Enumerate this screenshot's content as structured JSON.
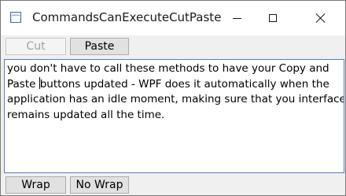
{
  "window": {
    "title": "CommandsCanExecuteCutPaste"
  },
  "toolbar": {
    "cut_label": "Cut",
    "paste_label": "Paste"
  },
  "editor": {
    "lines": [
      "you don't have to call these methods to have your Copy and",
      "Paste buttons updated - WPF does it automatically when the",
      "application has an idle moment, making sure that you interface",
      "remains updated all the time."
    ],
    "line2_before_caret": "Paste ",
    "line2_after_caret": "buttons updated - WPF does it automatically when the"
  },
  "bottombar": {
    "wrap_label": "Wrap",
    "nowrap_label": "No Wrap"
  },
  "icons": {
    "app": "window-app-icon",
    "minimize": "minimize-icon",
    "maximize": "maximize-icon",
    "close": "close-icon"
  },
  "colors": {
    "textbox_border": "#5b7fb8",
    "button_bg": "#e1e1e1",
    "disabled_text": "#a0a0a0"
  }
}
